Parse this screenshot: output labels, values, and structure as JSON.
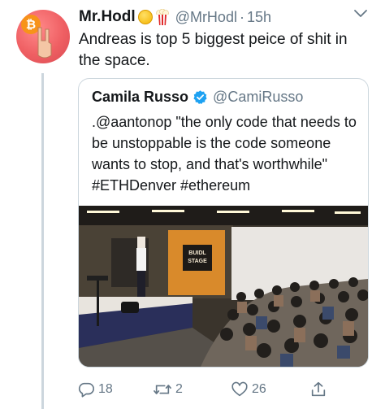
{
  "tweet": {
    "author_name": "Mr.Hodl",
    "author_handle": "@MrHodl",
    "separator": "·",
    "time": "15h",
    "text": "Andreas is top 5 biggest peice of shit in the space.",
    "avatar_icon": "bitcoin-rock-hand-avatar",
    "name_emojis": [
      "coin-emoji",
      "popcorn-emoji"
    ]
  },
  "quoted": {
    "author_name": "Camila Russo",
    "author_handle": "@CamiRusso",
    "verified": true,
    "text": ".@aantonop \"the only code that needs to be unstoppable is the code someone wants to stop, and that's worthwhile\" #ETHDenver #ethereum",
    "photo": {
      "sign_text": "BUIDL STAGE"
    }
  },
  "actions": {
    "reply_count": "18",
    "retweet_count": "2",
    "like_count": "26",
    "share_icon": "share-icon"
  },
  "colors": {
    "text": "#14171a",
    "secondary": "#657786",
    "border": "#ccd6dd",
    "verified": "#1da1f2",
    "avatar": "#ef5f63"
  }
}
